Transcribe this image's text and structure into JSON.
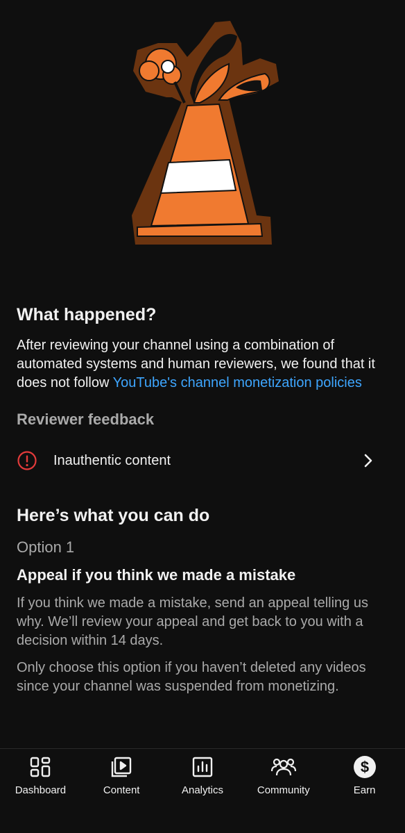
{
  "what_happened": {
    "title": "What happened?",
    "body_prefix": "After reviewing your channel using a combination of automated systems and human reviewers, we found that it does not follow ",
    "link_text": "YouTube's channel monetization policies"
  },
  "reviewer_feedback": {
    "title": "Reviewer feedback",
    "items": [
      {
        "label": "Inauthentic content",
        "icon": "alert-circle-icon",
        "status_color": "#e33b3b"
      }
    ]
  },
  "what_you_can_do": {
    "title": "Here’s what you can do",
    "options": [
      {
        "label": "Option 1",
        "title": "Appeal if you think we made a mistake",
        "paragraphs": [
          "If you think we made a mistake, send an appeal telling us why. We’ll review your appeal and get back to you with a decision within 14 days.",
          "Only choose this option if you haven’t deleted any videos since your channel was suspended from monetizing."
        ]
      }
    ]
  },
  "bottom_nav": {
    "items": [
      {
        "label": "Dashboard",
        "icon": "dashboard-icon"
      },
      {
        "label": "Content",
        "icon": "content-icon"
      },
      {
        "label": "Analytics",
        "icon": "analytics-icon"
      },
      {
        "label": "Community",
        "icon": "community-icon"
      },
      {
        "label": "Earn",
        "icon": "earn-icon",
        "active": true
      }
    ]
  },
  "colors": {
    "background": "#0f0f0f",
    "link": "#3ea6ff",
    "cone_orange": "#f07a30",
    "cone_outline": "#6b3410",
    "alert_red": "#e33b3b"
  }
}
